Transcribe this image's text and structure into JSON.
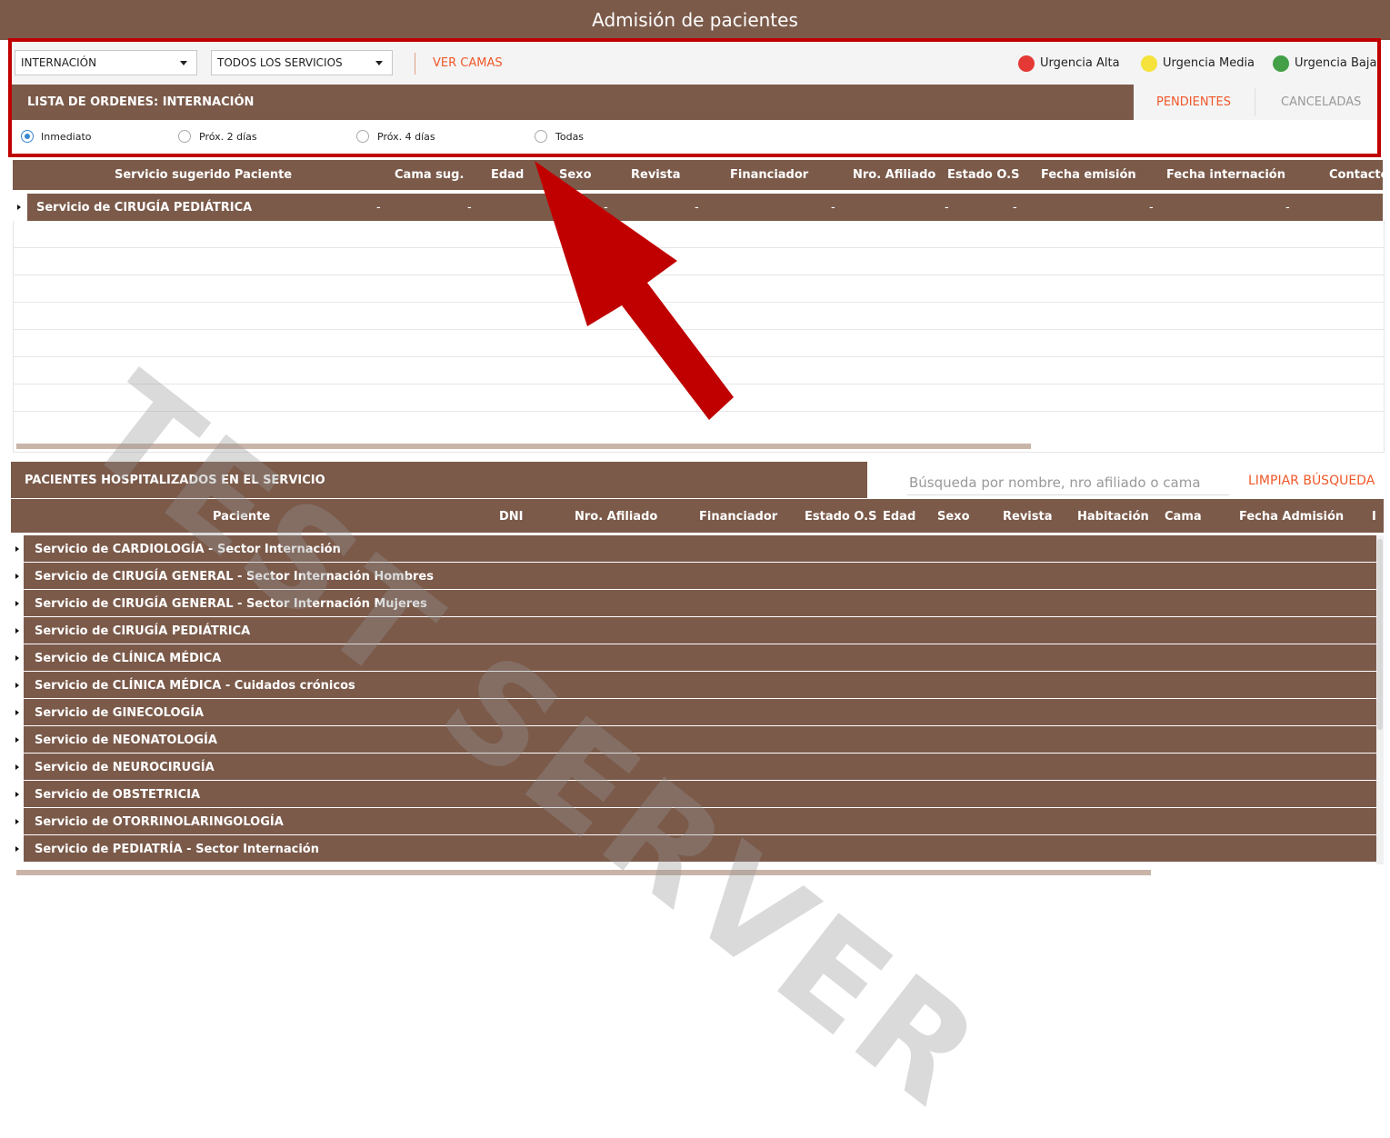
{
  "app": {
    "title": "Admisión de pacientes"
  },
  "toolbar": {
    "type_select": "INTERNACIÓN",
    "service_select": "TODOS LOS SERVICIOS",
    "view_beds": "VER CAMAS",
    "legend": [
      {
        "label": "Urgencia Alta",
        "color": "#e53935"
      },
      {
        "label": "Urgencia Media",
        "color": "#f5e23a"
      },
      {
        "label": "Urgencia Baja",
        "color": "#43a047"
      }
    ]
  },
  "orders": {
    "title": "LISTA DE ORDENES: INTERNACIÓN",
    "tabs": [
      {
        "label": "PENDIENTES",
        "active": true
      },
      {
        "label": "CANCELADAS",
        "active": false
      }
    ],
    "filters": [
      {
        "label": "Inmediato",
        "checked": true
      },
      {
        "label": "Próx. 2 días",
        "checked": false
      },
      {
        "label": "Próx. 4 días",
        "checked": false
      },
      {
        "label": "Todas",
        "checked": false
      }
    ],
    "columns": [
      "Servicio sugerido Paciente",
      "Cama sug.",
      "Edad",
      "Sexo",
      "Revista",
      "Financiador",
      "Nro. Afiliado",
      "Estado O.S",
      "Fecha emisión",
      "Fecha internación",
      "Contacto"
    ],
    "group_row": {
      "label": "Servicio de CIRUGÍA PEDIÁTRICA",
      "dash": "-"
    }
  },
  "hospitalized": {
    "title": "PACIENTES HOSPITALIZADOS EN EL SERVICIO",
    "search_placeholder": "Búsqueda por nombre, nro afiliado o cama",
    "clear_search": "LIMPIAR BÚSQUEDA",
    "columns": [
      "Paciente",
      "DNI",
      "Nro. Afiliado",
      "Financiador",
      "Estado O.S",
      "Edad",
      "Sexo",
      "Revista",
      "Habitación",
      "Cama",
      "Fecha Admisión",
      "I"
    ],
    "groups": [
      "Servicio de CARDIOLOGÍA - Sector Internación",
      "Servicio de CIRUGÍA GENERAL - Sector Internación Hombres",
      "Servicio de CIRUGÍA GENERAL - Sector Internación Mujeres",
      "Servicio de CIRUGÍA PEDIÁTRICA",
      "Servicio de CLÍNICA MÉDICA",
      "Servicio de CLÍNICA MÉDICA - Cuidados crónicos",
      "Servicio de GINECOLOGÍA",
      "Servicio de NEONATOLOGÍA",
      "Servicio de NEUROCIRUGÍA",
      "Servicio de OBSTETRICIA",
      "Servicio de OTORRINOLARINGOLOGÍA",
      "Servicio de PEDIATRÍA - Sector Internación"
    ]
  },
  "watermark": "TEST SERVER"
}
